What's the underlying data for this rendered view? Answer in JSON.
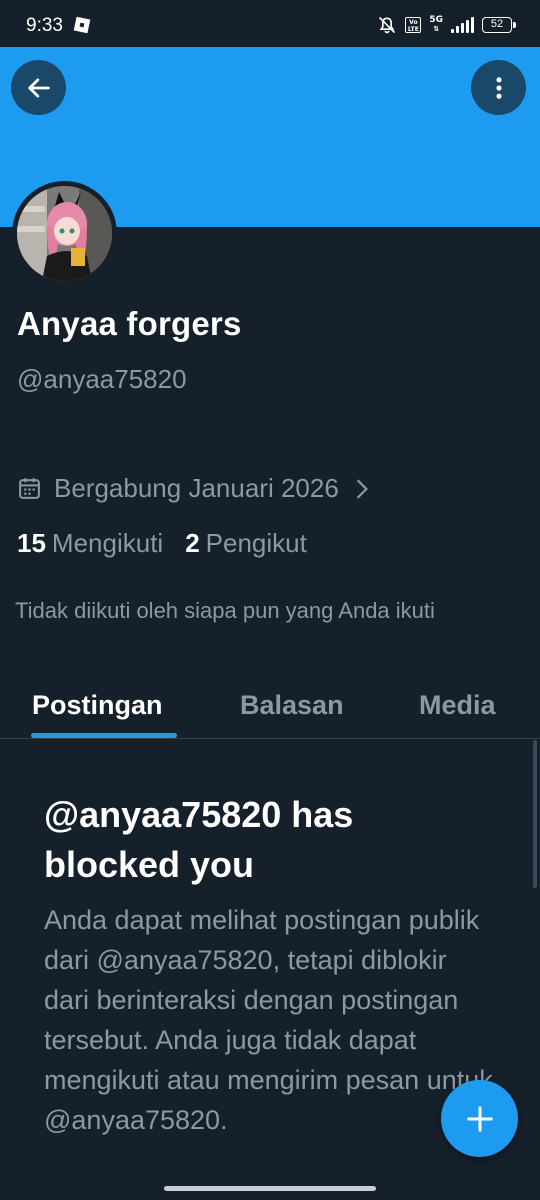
{
  "status_bar": {
    "time": "9:33",
    "volte": "Vo LTE",
    "network": "5G",
    "battery": "52"
  },
  "profile": {
    "display_name": "Anyaa forgers",
    "handle": "@anyaa75820",
    "joined": "Bergabung Januari 2026",
    "following_count": "15",
    "following_label": "Mengikuti",
    "followers_count": "2",
    "followers_label": "Pengikut",
    "not_followed_note": "Tidak diikuti oleh siapa pun yang Anda ikuti"
  },
  "tabs": [
    {
      "label": "Postingan",
      "active": true
    },
    {
      "label": "Balasan",
      "active": false
    },
    {
      "label": "Media",
      "active": false
    }
  ],
  "blocked": {
    "title": "@anyaa75820 has blocked you",
    "body": "Anda dapat melihat postingan publik dari @anyaa75820, tetapi diblokir dari berinteraksi dengan postingan tersebut. Anda juga tidak dapat mengikuti atau mengirim pesan untuk @anyaa75820."
  },
  "icons": {
    "back": "arrow-left-icon",
    "more": "more-vertical-icon",
    "calendar": "calendar-icon",
    "chevron": "chevron-right-icon",
    "compose": "plus-icon"
  },
  "colors": {
    "background": "#15202b",
    "banner": "#1d9bf0",
    "accent": "#1d9bf0",
    "secondary_text": "#8b98a5"
  }
}
